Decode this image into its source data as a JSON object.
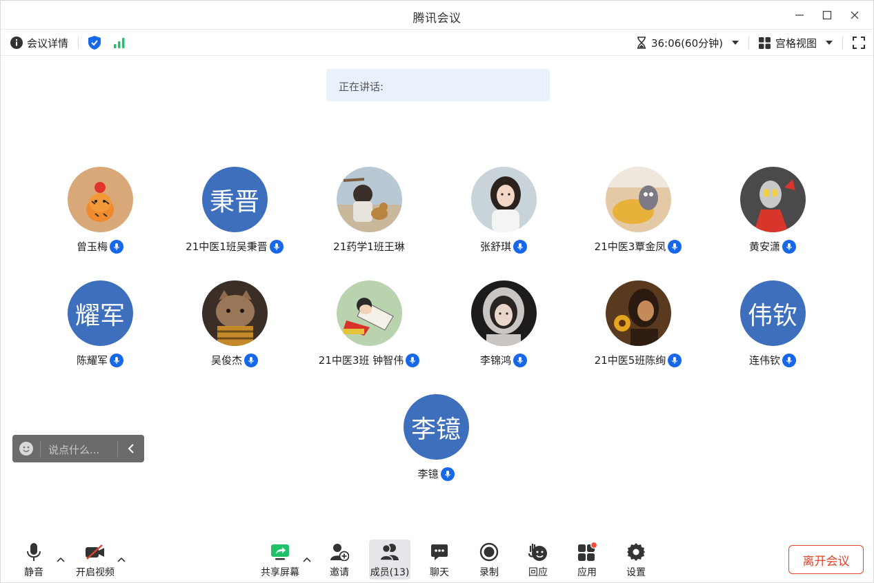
{
  "window": {
    "title": "腾讯会议"
  },
  "infobar": {
    "details_label": "会议详情",
    "timer": "36:06(60分钟)",
    "view_mode": "宫格视图"
  },
  "speaking": {
    "label": "正在讲话:"
  },
  "participants": [
    {
      "name": "曾玉梅",
      "avatar": "photo",
      "mic": true
    },
    {
      "name": "21中医1班吴秉晋",
      "avatar_text": "秉晋",
      "mic": true
    },
    {
      "name": "21药学1班王琳",
      "avatar": "photo",
      "mic": false
    },
    {
      "name": "张舒琪",
      "avatar": "photo",
      "mic": true
    },
    {
      "name": "21中医3覃金凤",
      "avatar": "photo",
      "mic": true
    },
    {
      "name": "黄安潇",
      "avatar": "photo",
      "mic": true
    },
    {
      "name": "陈耀军",
      "avatar_text": "耀军",
      "mic": true
    },
    {
      "name": "吴俊杰",
      "avatar": "photo",
      "mic": true
    },
    {
      "name": "21中医3班 钟智伟",
      "avatar": "photo",
      "mic": true
    },
    {
      "name": "李锦鸿",
      "avatar": "photo",
      "mic": true
    },
    {
      "name": "21中医5班陈绚",
      "avatar": "photo",
      "mic": true
    },
    {
      "name": "连伟钦",
      "avatar_text": "伟钦",
      "mic": true
    },
    {
      "name": "李镱",
      "avatar_text": "李镱",
      "mic": true
    }
  ],
  "chat": {
    "placeholder": "说点什么..."
  },
  "toolbar": {
    "mute": "静音",
    "video": "开启视频",
    "share": "共享屏幕",
    "invite": "邀请",
    "members": "成员(13)",
    "chat": "聊天",
    "record": "录制",
    "react": "回应",
    "apps": "应用",
    "settings": "设置",
    "leave": "离开会议"
  },
  "colors": {
    "accent_blue": "#1668e8",
    "avatar_blue": "#3e6fbc",
    "signal_green": "#21c16b",
    "leave_red": "#e0442b",
    "notification_red": "#f04b3b"
  }
}
